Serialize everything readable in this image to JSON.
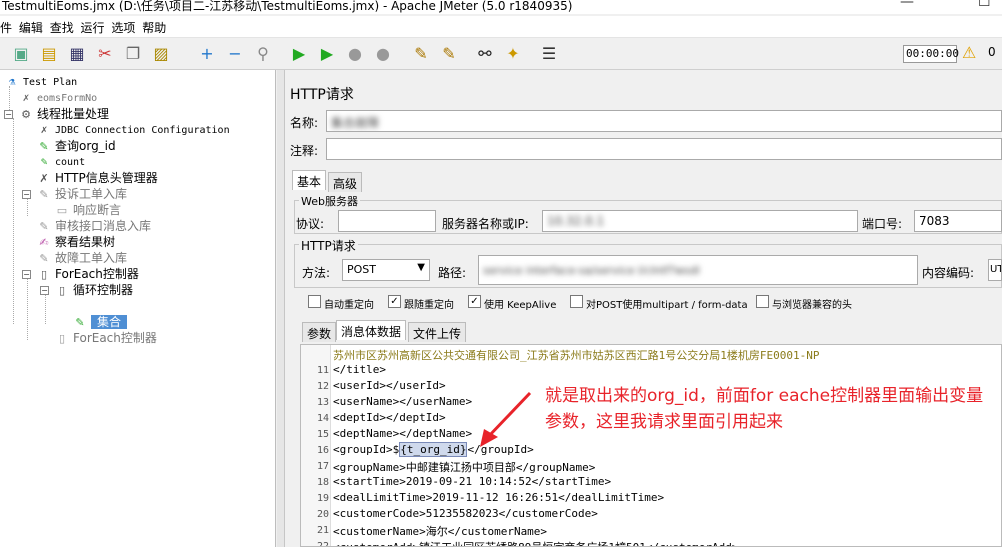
{
  "window": {
    "title": "TestmultiEoms.jmx (D:\\任务\\项目二-江苏移动\\TestmultiEoms.jmx) - Apache JMeter (5.0 r1840935)"
  },
  "menu": [
    "件",
    "编辑",
    "查找",
    "运行",
    "选项",
    "帮助"
  ],
  "toolbar": {
    "timer": "00:00:00",
    "warn_count": "0",
    "icons": [
      "new-icon",
      "templates-icon",
      "open-icon",
      "save-icon",
      "cut-icon",
      "copy-icon",
      "paste-icon",
      "expand-icon",
      "collapse-icon",
      "toggle-icon",
      "start-icon",
      "start-no-pause-icon",
      "stop-icon",
      "shutdown-icon",
      "clear-icon",
      "clear-all-icon",
      "search-icon",
      "reset-search-icon",
      "function-helper-icon"
    ]
  },
  "tree": {
    "nodes": [
      {
        "label": "Test Plan",
        "icon": "test-plan-icon"
      },
      {
        "label": "eomsFormNo",
        "icon": "config-icon"
      },
      {
        "label": "线程批量处理",
        "icon": "thread-group-icon"
      },
      {
        "label": "JDBC Connection Configuration",
        "icon": "config-icon"
      },
      {
        "label": "查询org_id",
        "icon": "jdbc-sampler-icon"
      },
      {
        "label": "count",
        "icon": "sampler-icon"
      },
      {
        "label": "HTTP信息头管理器",
        "icon": "config-icon"
      },
      {
        "label": "投诉工单入库",
        "icon": "sampler-icon"
      },
      {
        "label": "响应断言",
        "icon": "assertion-icon"
      },
      {
        "label": "审核接口消息入库",
        "icon": "sampler-icon"
      },
      {
        "label": "察看结果树",
        "icon": "listener-icon"
      },
      {
        "label": "故障工单入库",
        "icon": "sampler-icon"
      },
      {
        "label": "ForEach控制器",
        "icon": "controller-icon"
      },
      {
        "label": "循环控制器",
        "icon": "controller-icon"
      },
      {
        "label": "集合",
        "icon": "sampler-icon"
      },
      {
        "label": "ForEach控制器",
        "icon": "controller-icon"
      }
    ]
  },
  "panel": {
    "title": "HTTP请求",
    "name_label": "名称:",
    "name_value": "集合故障",
    "comment_label": "注释:",
    "tabs": [
      "基本",
      "高级"
    ],
    "web_server": {
      "legend": "Web服务器",
      "protocol_label": "协议:",
      "server_label": "服务器名称或IP:",
      "server_value": "10.32.0.1",
      "port_label": "端口号:",
      "port_value": "7083"
    },
    "http_request": {
      "legend": "HTTP请求",
      "method_label": "方法:",
      "method_value": "POST",
      "path_label": "路径:",
      "path_value": "service interface-sa/service                    l/cIntf?wsdl",
      "encoding_label": "内容编码:",
      "encoding_value": "UTF"
    },
    "checkboxes": [
      {
        "label": "自动重定向",
        "checked": false
      },
      {
        "label": "跟随重定向",
        "checked": true
      },
      {
        "label": "使用 KeepAlive",
        "checked": true
      },
      {
        "label": "对POST使用multipart / form-data",
        "checked": false
      },
      {
        "label": "与浏览器兼容的头",
        "checked": false
      }
    ],
    "sub_tabs": [
      "参数",
      "消息体数据",
      "文件上传"
    ]
  },
  "editor": {
    "lines": [
      {
        "n": "",
        "text": "苏州市区苏州高新区公共交通有限公司_江苏省苏州市姑苏区西汇路1号公交分局1楼机房FE0001-NP"
      },
      {
        "n": "11",
        "text": "</title>"
      },
      {
        "n": "12",
        "text": "<userId></userId>"
      },
      {
        "n": "13",
        "text": "<userName></userName>"
      },
      {
        "n": "14",
        "text": "<deptId></deptId>"
      },
      {
        "n": "15",
        "text": "<deptName></deptName>"
      },
      {
        "n": "16",
        "text": "<groupId>${t_org_id}</groupId>"
      },
      {
        "n": "17",
        "text": "<groupName>中邮建镇江扬中项目部</groupName>"
      },
      {
        "n": "18",
        "text": "<startTime>2019-09-21 10:14:52</startTime>"
      },
      {
        "n": "19",
        "text": "<dealLimitTime>2019-11-12 16:26:51</dealLimitTime>"
      },
      {
        "n": "20",
        "text": "<customerCode>51235582023</customerCode>"
      },
      {
        "n": "21",
        "text": "<customerName>海尔</customerName>"
      },
      {
        "n": "22",
        "text": "<customerAdd>镇江工业园区苏绣路89号恒宇商务广场1幢501</customerAdd>"
      }
    ],
    "groupId_open": "<groupId>$",
    "groupId_var": "{t_org_id}",
    "groupId_close": "</groupId>"
  },
  "annotation": {
    "text": "就是取出来的org_id，前面for eache控制器里面输出变量参数，这里我请求里面引用起来"
  }
}
